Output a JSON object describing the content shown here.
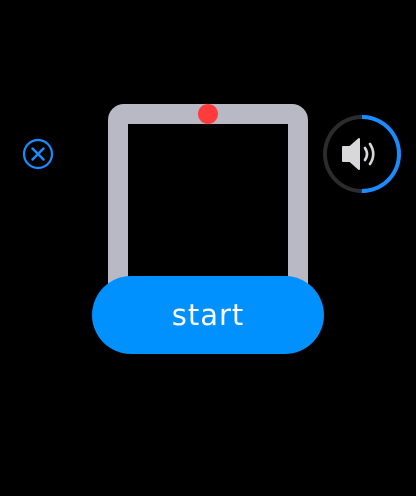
{
  "close_button": {
    "icon": "close-circle-icon"
  },
  "track": {
    "icon": "square-track",
    "marker_position": "top-center"
  },
  "volume": {
    "icon": "speaker-icon",
    "level": 0.5
  },
  "start_button": {
    "label": "start"
  },
  "colors": {
    "background": "#000000",
    "accent": "#1a8cff",
    "button": "#0091ff",
    "track": "#b9b9c6",
    "marker": "#ff3b3b",
    "ring_background": "#2c2c2e",
    "speaker": "#d8d8da"
  }
}
